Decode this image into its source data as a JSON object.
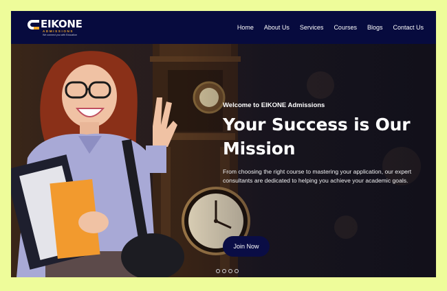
{
  "brand": {
    "name": "EIKONE",
    "subtitle": "ADMISSIONS",
    "tagline": "We connect you with Education",
    "logo_icon": "eikone-logo-mark",
    "accent_color": "#f4a82a"
  },
  "nav": {
    "background": "#070b3e",
    "items": [
      {
        "label": "Home"
      },
      {
        "label": "About Us"
      },
      {
        "label": "Services"
      },
      {
        "label": "Courses"
      },
      {
        "label": "Blogs"
      },
      {
        "label": "Contact Us"
      }
    ]
  },
  "hero": {
    "eyebrow": "Welcome to EIKONE Admissions",
    "title_line1": "Your Success is Our",
    "title_line2": "Mission",
    "description": "From choosing the right course to mastering your application, our expert consultants are dedicated to helping you achieve your academic goals.",
    "cta_label": "Join Now",
    "cta_color": "#0a0d45",
    "slides": 4
  },
  "page_background": "#eefc9a"
}
